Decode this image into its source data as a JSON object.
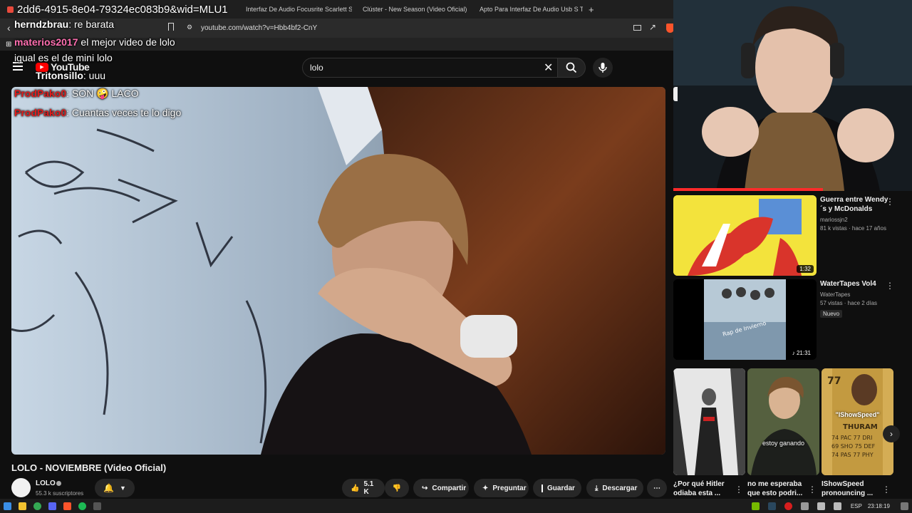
{
  "browser": {
    "tabs": [
      {
        "label": "2dd6-4915-8e04-79324ec083b9&wid=MLU1",
        "color": "#e84a3c"
      },
      {
        "label": "Interfaz De Audio Focusrite Scarlett S",
        "color": "#d6354c"
      },
      {
        "label": "Clúster - New Season (Video Oficial)",
        "color": "#ff0000"
      },
      {
        "label": "Apto Para Interfaz De Audio Usb S Te",
        "color": "#ffe600"
      }
    ],
    "new_tab": "+",
    "url": "youtube.com/watch?v=Hbb4bf2-CnY"
  },
  "youtube": {
    "logo": "YouTube",
    "search_value": "lolo"
  },
  "chat": [
    {
      "user": "herndzbrau",
      "text": ": re barata",
      "color": "#ffffff"
    },
    {
      "user": "materios2017",
      "text": " el mejor video de lolo",
      "color": "#ff6fb0"
    },
    {
      "user": "",
      "text": "igual es el de mini lolo",
      "color": "#ffffff"
    },
    {
      "user": "Tritonsillo",
      "text": ": uuu",
      "color": "#ffffff"
    },
    {
      "user": "ProdPako0",
      "text": ": SON 🤪 LACO",
      "color": "#e01e1e"
    },
    {
      "user": "ProdPako0",
      "text": ": Cuantas veces te lo digo",
      "color": "#e01e1e"
    }
  ],
  "video": {
    "title": "LOLO - NOVIEMBRE (Video Oficial)",
    "channel": "LOLO",
    "subscribers": "55.3 k suscriptores",
    "likes": "5.1 K",
    "share": "Compartir",
    "ask": "Preguntar",
    "save": "Guardar",
    "download": "Descargar"
  },
  "suggestions": [
    {
      "title": "Guerra entre Wendy ´s y McDonalds",
      "channel": "mariossjn2",
      "meta": "81 k vistas · hace 17 años",
      "duration": "1:32",
      "badge": ""
    },
    {
      "title": "WaterTapes Vol4",
      "channel": "WaterTapes",
      "meta": "57 vistas · hace 2 días",
      "duration": "♪ 21:31",
      "badge": "Nuevo"
    }
  ],
  "shorts": [
    {
      "title": "¿Por qué Hitler odiaba esta ...",
      "overlay": ""
    },
    {
      "title": "no me esperaba que esto podri...",
      "overlay": "estoy ganando"
    },
    {
      "title": "IShowSpeed pronouncing ...",
      "overlay": "\"IShowSpeed\""
    }
  ],
  "taskbar": {
    "lang": "ESP",
    "clock": "23:18:19"
  }
}
